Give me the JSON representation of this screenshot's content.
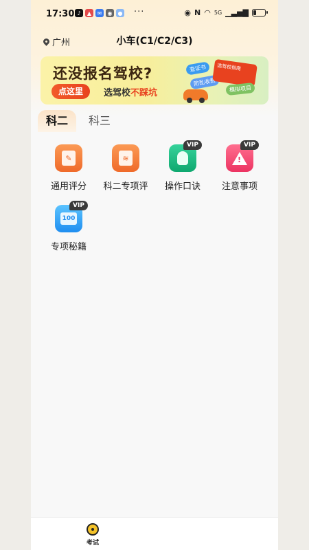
{
  "status_bar": {
    "time": "17:30",
    "more": "···",
    "network": "5G"
  },
  "header": {
    "city": "广州",
    "car_type": "小车(C1/C2/C3)"
  },
  "banner": {
    "title": "还没报名驾校?",
    "button": "点这里",
    "subtitle_prefix": "选驾校",
    "subtitle_highlight": "不踩坑",
    "tag_1": "查证书",
    "tag_2": "防乱收费",
    "tag_3": "模拟项目",
    "ticket_text": "选驾校指南"
  },
  "tabs": [
    {
      "label": "科二",
      "active": true
    },
    {
      "label": "科三",
      "active": false
    }
  ],
  "grid": [
    {
      "label": "通用评分",
      "icon": "score-doc-icon",
      "color": "#ef6a2a",
      "vip": false
    },
    {
      "label": "科二专项评",
      "icon": "layers-doc-icon",
      "color": "#ef6a2a",
      "vip": false
    },
    {
      "label": "操作口诀",
      "icon": "lightbulb-icon",
      "color": "#0fa86f",
      "vip": true
    },
    {
      "label": "注意事项",
      "icon": "warning-icon",
      "color": "#ec3462",
      "vip": true
    },
    {
      "label": "专项秘籍",
      "icon": "score-book-icon",
      "color": "#1f8ef0",
      "vip": true
    }
  ],
  "vip_badge": "VIP",
  "book_icon_text": "100",
  "bottom_nav": {
    "exam_label": "考试"
  }
}
